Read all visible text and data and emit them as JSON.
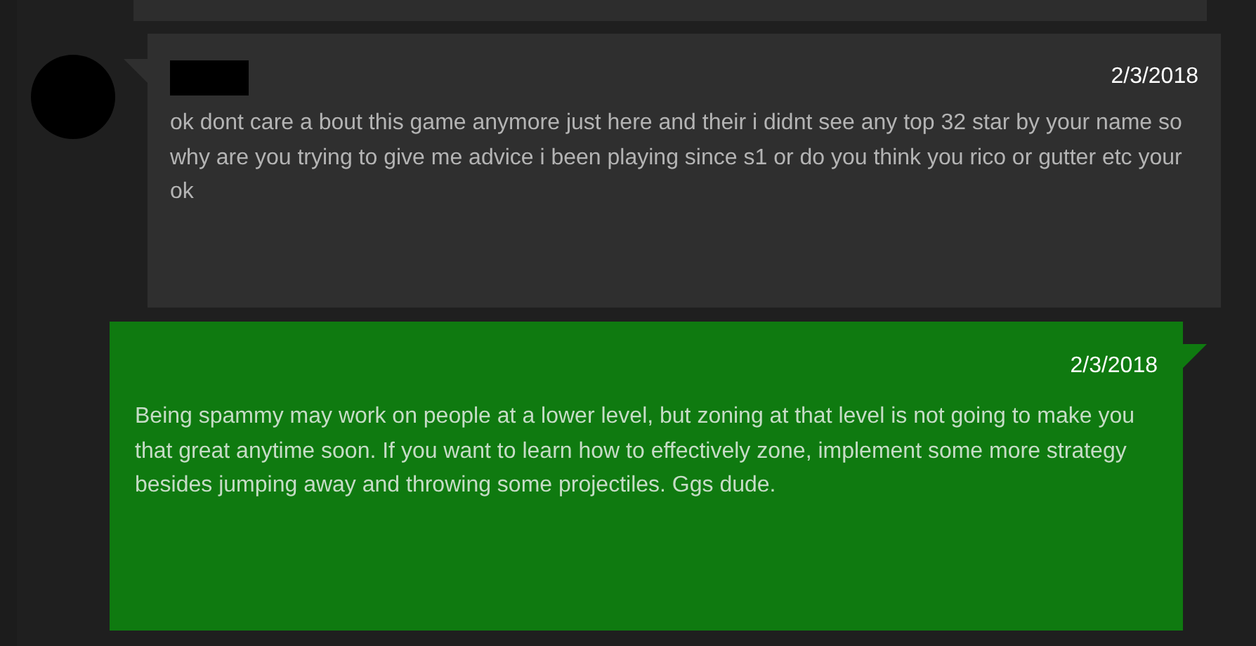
{
  "messages": [
    {
      "kind": "received",
      "date": "2/3/2018",
      "text": "ok dont care a bout this game anymore just here and their i didnt see any top 32 star by your name so why are you trying to give me advice i been playing since s1 or do you think you rico or gutter etc your ok"
    },
    {
      "kind": "sent",
      "date": "2/3/2018",
      "text": "Being spammy may work on people at a lower level, but zoning at that level is not going to make you that great anytime soon. If you want to learn how to effectively zone, implement some more strategy besides jumping away and throwing some projectiles. Ggs dude."
    }
  ]
}
